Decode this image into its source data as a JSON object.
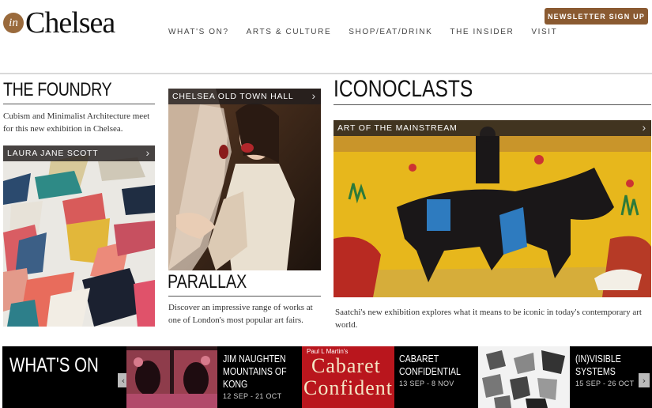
{
  "header": {
    "logo_in": "in",
    "logo_text": "Chelsea",
    "nav": [
      "WHAT'S ON?",
      "ARTS & CULTURE",
      "SHOP/EAT/DRINK",
      "THE INSIDER",
      "VISIT"
    ],
    "newsletter_label": "NEWSLETTER SIGN UP"
  },
  "col1": {
    "title": "THE FOUNDRY",
    "text": "Cubism and Minimalist Architecture meet for this new exhibition in Chelsea.",
    "card_label": "LAURA JANE SCOTT"
  },
  "col2": {
    "card_label": "CHELSEA OLD TOWN HALL",
    "title": "PARALLAX",
    "text": "Discover an impressive range of works at one of London's most popular art fairs."
  },
  "col3": {
    "title": "ICONOCLASTS",
    "card_label": "ART OF THE MAINSTREAM",
    "text": "Saatchi's new exhibition explores what it means to be iconic in today's contemporary art world."
  },
  "whats_on": {
    "heading": "WHAT'S ON",
    "events": [
      {
        "title_line1": "JIM NAUGHTEN",
        "title_line2": "MOUNTAINS OF",
        "title_line3": "KONG",
        "date": "12 SEP - 21 OCT"
      },
      {
        "title_line1": "CABARET",
        "title_line2": "CONFIDENTIAL",
        "date": "13 SEP - 8 NOV",
        "poster_line1": "Paul L Martin's",
        "poster_line2": "Cabaret",
        "poster_line3": "Confident"
      },
      {
        "title_line1": "(IN)VISIBLE",
        "title_line2": "SYSTEMS",
        "date": "15 SEP - 26 OCT"
      }
    ]
  },
  "colors": {
    "accent": "#8a5a31",
    "label_bg": "#231e1e",
    "strip_bg": "#000000"
  }
}
